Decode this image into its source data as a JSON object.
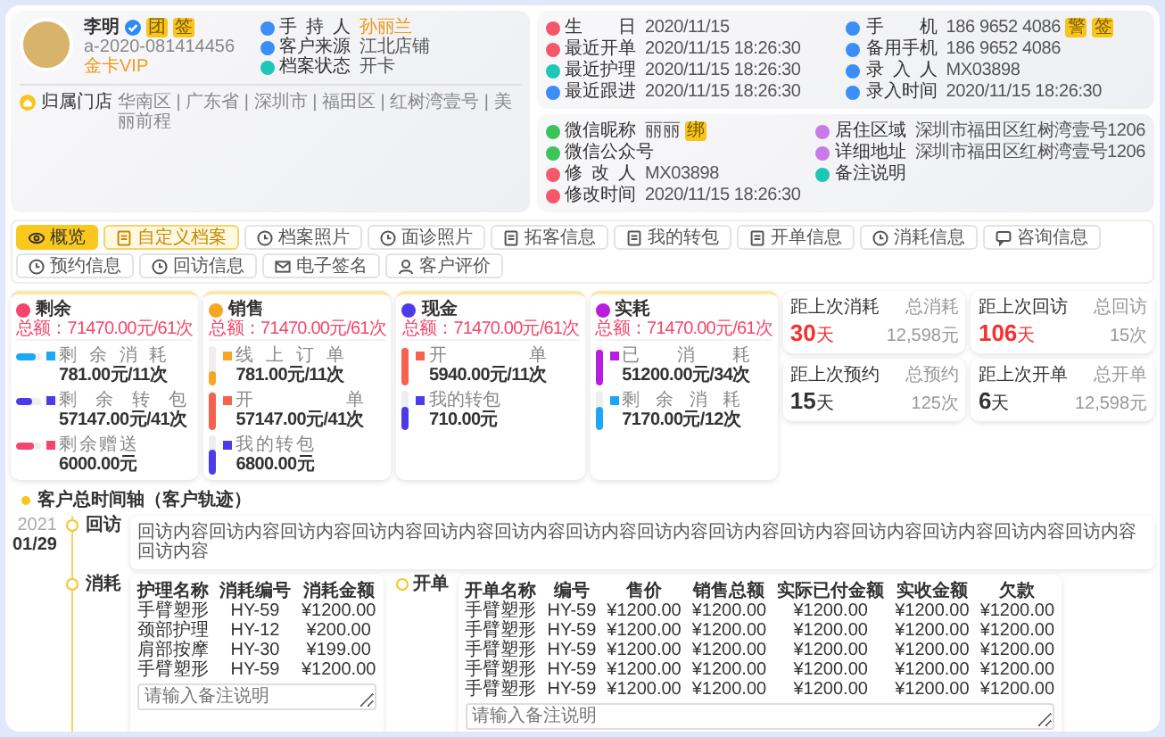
{
  "profile": {
    "name": "李明",
    "name_badges": [
      "团",
      "签"
    ],
    "member_id": "a-2020-081414456",
    "member_level": "金卡VIP",
    "fields": [
      {
        "label": "手 持 人",
        "value": "孙丽兰",
        "color": "#3a8ef6",
        "kind": "highlight"
      },
      {
        "label": "客户来源",
        "value": "江北店铺",
        "color": "#3a8ef6",
        "kind": "plain"
      },
      {
        "label": "档案状态",
        "value": "开卡",
        "color": "#1cc7b6",
        "kind": "plain"
      }
    ],
    "store_label": "归属门店",
    "store_path": "华南区 | 广东省 | 深圳市 | 福田区 | 红树湾壹号 | 美丽前程"
  },
  "info_cards": [
    {
      "columns": [
        [
          {
            "label": "生 日",
            "value": "2020/11/15",
            "color": "#f5576c"
          },
          {
            "label": "最近开单",
            "value": "2020/11/15 18:26:30",
            "color": "#f5576c"
          },
          {
            "label": "最近护理",
            "value": "2020/11/15 18:26:30",
            "color": "#1cc7b6"
          },
          {
            "label": "最近跟进",
            "value": "2020/11/15 18:26:30",
            "color": "#3a8ef6"
          }
        ],
        [
          {
            "label": "手 机",
            "value": "186 9652 4086",
            "color": "#3a8ef6",
            "badges": [
              "警",
              "签"
            ]
          },
          {
            "label": "备用手机",
            "value": "186 9652 4086",
            "color": "#3a8ef6"
          },
          {
            "label": "录 入 人",
            "value": "MX03898",
            "color": "#3a8ef6"
          },
          {
            "label": "录入时间",
            "value": "2020/11/15 18:26:30",
            "color": "#3a8ef6"
          }
        ]
      ]
    },
    {
      "columns": [
        [
          {
            "label": "微信昵称",
            "value": "丽丽",
            "color": "#3cc35a",
            "badges": [
              "绑"
            ]
          },
          {
            "label": "微信公众号",
            "color": "#3cc35a"
          },
          {
            "label": "修 改 人",
            "value": "MX03898",
            "color": "#f5576c"
          },
          {
            "label": "修改时间",
            "value": "2020/11/15 18:26:30",
            "color": "#f5576c"
          }
        ],
        [
          {
            "label": "居住区域",
            "value": "深圳市福田区红树湾壹号1206",
            "color": "#c77ae8"
          },
          {
            "label": "详细地址",
            "value": "深圳市福田区红树湾壹号1206",
            "color": "#c77ae8"
          },
          {
            "label": "备注说明",
            "color": "#1cc7b6"
          }
        ]
      ]
    }
  ],
  "tabs": [
    {
      "label": "概览",
      "selected": true,
      "highlighted": false
    },
    {
      "label": "自定义档案",
      "selected": false,
      "highlighted": true
    },
    {
      "label": "档案照片",
      "selected": false,
      "highlighted": false
    },
    {
      "label": "面诊照片",
      "selected": false,
      "highlighted": false
    },
    {
      "label": "拓客信息",
      "selected": false,
      "highlighted": false
    },
    {
      "label": "我的转包",
      "selected": false,
      "highlighted": false
    },
    {
      "label": "开单信息",
      "selected": false,
      "highlighted": false
    },
    {
      "label": "消耗信息",
      "selected": false,
      "highlighted": false
    },
    {
      "label": "咨询信息",
      "selected": false,
      "highlighted": false
    },
    {
      "label": "预约信息",
      "selected": false,
      "highlighted": false
    },
    {
      "label": "回访信息",
      "selected": false,
      "highlighted": false
    },
    {
      "label": "电子签名",
      "selected": false,
      "highlighted": false
    },
    {
      "label": "客户评价",
      "selected": false,
      "highlighted": false
    }
  ],
  "stats": [
    {
      "title": "剩余",
      "color": "#f5456c",
      "total": "总额：71470.00元/61次",
      "kind": "donut",
      "items": [
        {
          "label": "剩余消耗",
          "value": "781.00元/11次",
          "color": "#1ea7f5",
          "level": 0.8
        },
        {
          "label": "剩余转包",
          "value": "57147.00元/41次",
          "color": "#4b3bea",
          "level": 0.65
        },
        {
          "label": "剩余赠送",
          "value": "6000.00元",
          "color": "#f5456c",
          "level": 0.7
        }
      ]
    },
    {
      "title": "销售",
      "color": "#f5a623",
      "total": "总额：71470.00元/61次",
      "kind": "bars",
      "items": [
        {
          "label": "线上订单",
          "value": "781.00元/11次",
          "color": "#f5a623",
          "level": 0.35
        },
        {
          "label": "开 单",
          "value": "57147.00元/41次",
          "color": "#f8614f",
          "level": 0.95
        },
        {
          "label": "我的转包",
          "value": "6800.00元",
          "color": "#4b3bea",
          "level": 0.65
        }
      ]
    },
    {
      "title": "现金",
      "color": "#4b3bea",
      "total": "总额：71470.00元/61次",
      "kind": "bars",
      "items": [
        {
          "label": "开 单",
          "value": "5940.00元/11次",
          "color": "#f8614f",
          "level": 0.95
        },
        {
          "label": "我的转包",
          "value": "710.00元",
          "color": "#4b3bea",
          "level": 0.6
        }
      ]
    },
    {
      "title": "实耗",
      "color": "#b81ee0",
      "total": "总额：71470.00元/61次",
      "kind": "bars",
      "items": [
        {
          "label": "已 消 耗",
          "value": "51200.00元/34次",
          "color": "#b81ee0",
          "level": 0.9
        },
        {
          "label": "剩余消耗",
          "value": "7170.00元/12次",
          "color": "#1ea7f5",
          "level": 0.6
        }
      ]
    }
  ],
  "mini_stats": [
    {
      "label": "距上次消耗",
      "total_label": "总消耗",
      "value": "30",
      "unit": "天",
      "total": "12,598元",
      "alert": true
    },
    {
      "label": "距上次回访",
      "total_label": "总回访",
      "value": "106",
      "unit": "天",
      "total": "15次",
      "alert": true
    },
    {
      "label": "距上次预约",
      "total_label": "总预约",
      "value": "15",
      "unit": "天",
      "total": "125次",
      "alert": false
    },
    {
      "label": "距上次开单",
      "total_label": "总开单",
      "value": "6",
      "unit": "天",
      "total": "12,598元",
      "alert": false
    }
  ],
  "timeline": {
    "title": "客户总时间轴（客户轨迹）",
    "year": "2021",
    "date": "01/29",
    "entries": [
      {
        "kind": "note",
        "label": "回访",
        "text": "回访内容回访内容回访内容回访内容回访内容回访内容回访内容回访内容回访内容回访内容回访内容回访内容回访内容回访内容回访内容"
      },
      {
        "kind": "table",
        "label": "消耗",
        "columns": [
          "护理名称",
          "消耗编号",
          "消耗金额"
        ],
        "rows": [
          [
            "手臂塑形",
            "HY-59",
            "¥1200.00"
          ],
          [
            "颈部护理",
            "HY-12",
            "¥200.00"
          ],
          [
            "肩部按摩",
            "HY-30",
            "¥199.00"
          ],
          [
            "手臂塑形",
            "HY-59",
            "¥1200.00"
          ]
        ],
        "remark_placeholder": "请输入备注说明"
      },
      {
        "kind": "table",
        "label": "开单",
        "columns": [
          "开单名称",
          "编号",
          "售价",
          "销售总额",
          "实际已付金额",
          "实收金额",
          "欠款"
        ],
        "rows": [
          [
            "手臂塑形",
            "HY-59",
            "¥1200.00",
            "¥1200.00",
            "¥1200.00",
            "¥1200.00",
            "¥1200.00"
          ],
          [
            "手臂塑形",
            "HY-59",
            "¥1200.00",
            "¥1200.00",
            "¥1200.00",
            "¥1200.00",
            "¥1200.00"
          ],
          [
            "手臂塑形",
            "HY-59",
            "¥1200.00",
            "¥1200.00",
            "¥1200.00",
            "¥1200.00",
            "¥1200.00"
          ],
          [
            "手臂塑形",
            "HY-59",
            "¥1200.00",
            "¥1200.00",
            "¥1200.00",
            "¥1200.00",
            "¥1200.00"
          ],
          [
            "手臂塑形",
            "HY-59",
            "¥1200.00",
            "¥1200.00",
            "¥1200.00",
            "¥1200.00",
            "¥1200.00"
          ]
        ],
        "remark_placeholder": "请输入备注说明"
      }
    ]
  }
}
